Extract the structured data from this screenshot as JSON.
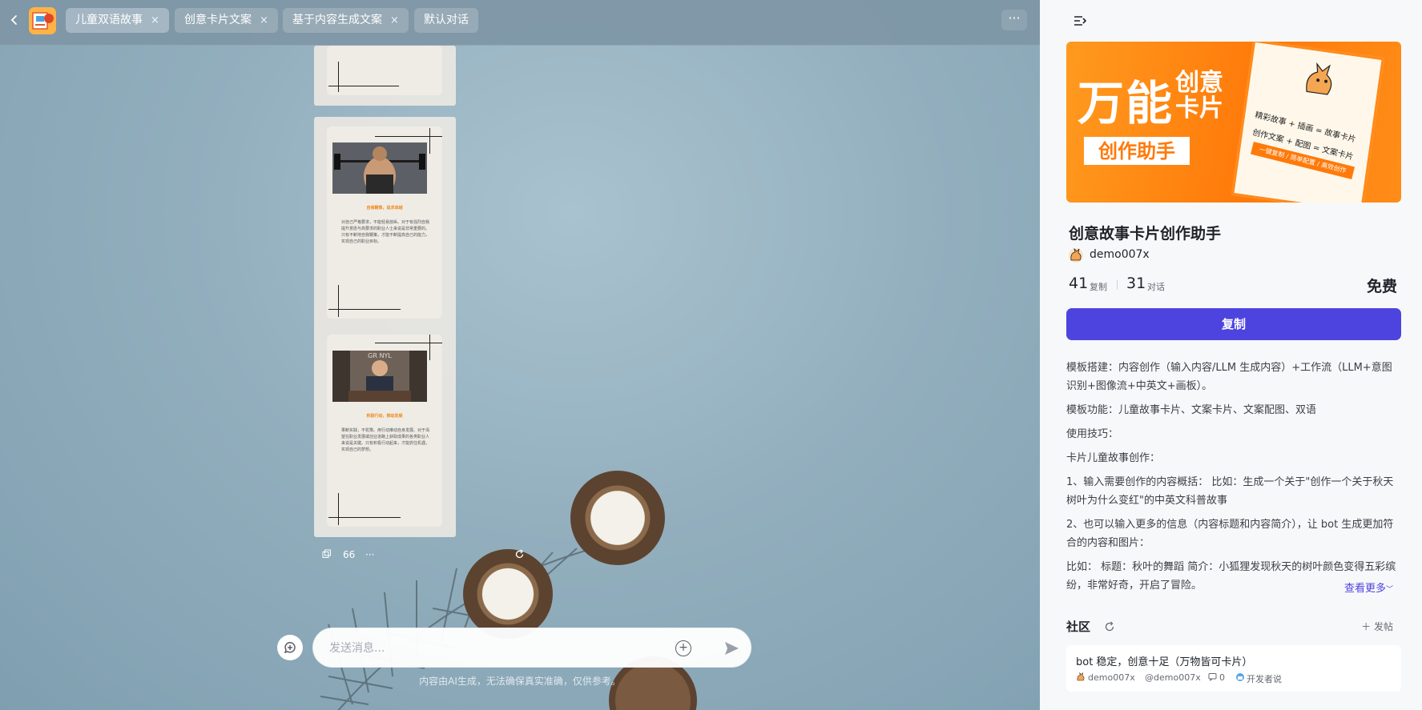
{
  "tabs": [
    {
      "label": "儿童双语故事",
      "closable": true,
      "active": true
    },
    {
      "label": "创意卡片文案",
      "closable": true,
      "active": false
    },
    {
      "label": "基于内容生成文案",
      "closable": true,
      "active": false
    },
    {
      "label": "默认对话",
      "closable": false,
      "active": false
    }
  ],
  "close_glyph": "×",
  "more_glyph": "···",
  "cards": [
    {
      "heading": "自我鞭策，追求卓越",
      "body": "对自己严格要求，不能轻易放纵。对于有强烈自我提升意愿与高要求的职业人士来说是非常重要的。只有不断地自我鞭策，才能不断提高自己的能力，实现自己的职业目标。"
    },
    {
      "heading": "积极行动，推动发展",
      "photo_text": "GR NYL",
      "body": "果断实践，不犹豫。用行动推动自身发展。对于渴望在职业发展或创业道路上获取成果的各类职业人来说是关键。只有积极行动起来，才能抓住机遇，实现自己的梦想。"
    }
  ],
  "message_actions": {
    "quote_count": "66",
    "more": "···"
  },
  "input": {
    "placeholder": "发送消息..."
  },
  "disclaimer": "内容由AI生成，无法确保真实准确，仅供参考。",
  "panel": {
    "banner": {
      "big_text": "万能",
      "small_line1": "创意",
      "small_line2": "卡片",
      "sub_text": "创作助手",
      "paper_line1": "精彩故事 + 插画 = 故事卡片",
      "paper_line2": "创作文案 + 配图 = 文案卡片",
      "paper_line3": "一键复制 / 简单配置 / 高效创作"
    },
    "title": "创意故事卡片创作助手",
    "author": "demo007x",
    "copies_num": "41",
    "copies_label": "复制",
    "chats_num": "31",
    "chats_label": "对话",
    "price": "免费",
    "copy_button": "复制",
    "description": [
      "模板搭建：内容创作（输入内容/LLM 生成内容）+工作流（LLM+意图识别+图像流+中英文+画板）。",
      "模板功能：儿童故事卡片、文案卡片、文案配图、双语",
      "使用技巧：",
      "卡片儿童故事创作：",
      "1、输入需要创作的内容概括： 比如：生成一个关于\"创作一个关于秋天树叶为什么变红\"的中英文科普故事",
      "2、也可以输入更多的信息（内容标题和内容简介），让 bot 生成更加符合的内容和图片：",
      "比如： 标题：秋叶的舞蹈 简介：小狐狸发现秋天的树叶颜色变得五彩缤纷，非常好奇，开启了冒险。"
    ],
    "see_more": "查看更多",
    "community_title": "社区",
    "post_button": "发帖",
    "post_title": "bot 稳定，创意十足（万物皆可卡片）",
    "post_author": "demo007x",
    "post_handle": "@demo007x",
    "post_comments": "0",
    "post_tag": "开发者说"
  },
  "icons": {
    "back": "chevron-left-icon",
    "more": "more-horizontal-icon",
    "copy": "copy-icon",
    "quote": "quote-icon",
    "regenerate": "refresh-icon",
    "new_chat": "new-chat-icon",
    "attach": "plus-circle-icon",
    "send": "send-icon",
    "collapse": "collapse-panel-icon",
    "comment": "comment-icon"
  },
  "colors": {
    "accent": "#4d44e0",
    "banner_orange": "#ff7a0a",
    "card_heading": "#f08a1c"
  }
}
